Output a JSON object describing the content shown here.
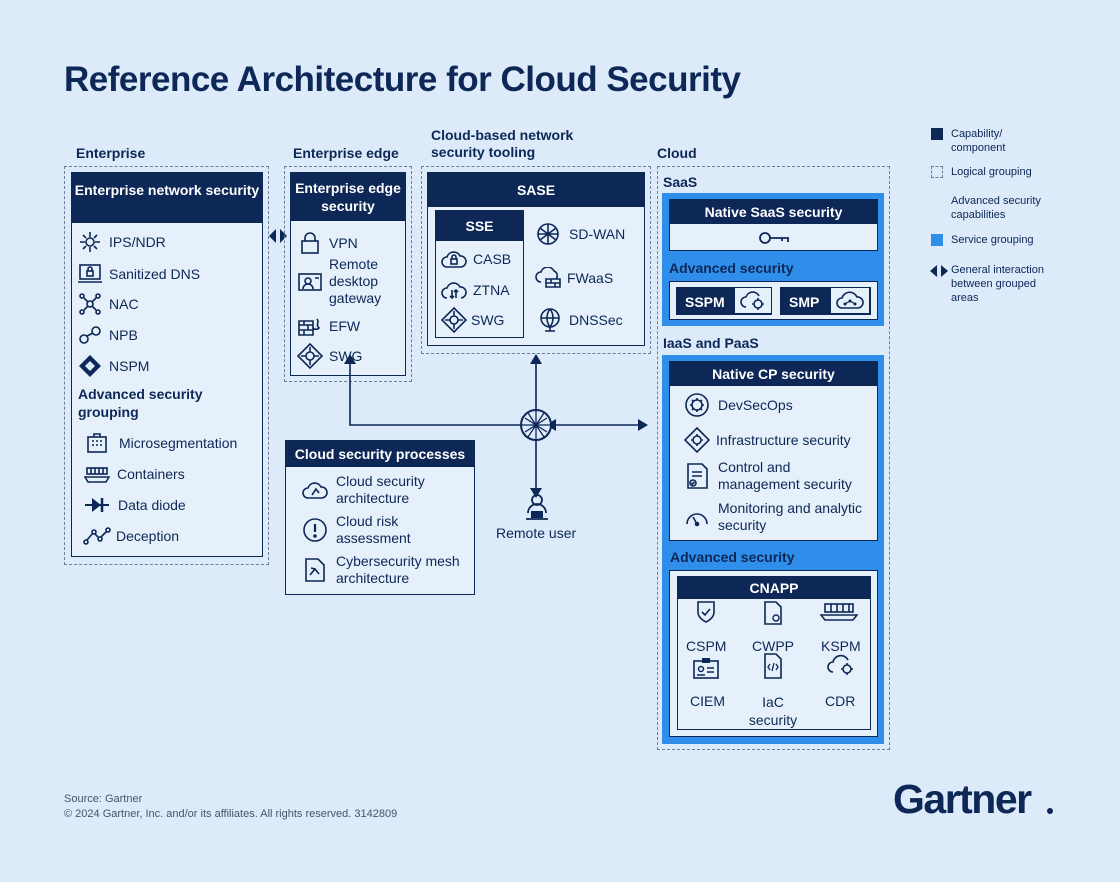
{
  "title": "Reference Architecture for Cloud Security",
  "columns": {
    "enterprise": "Enterprise",
    "enterprise_edge": "Enterprise edge",
    "cloud_network": "Cloud-based network security tooling",
    "cloud": "Cloud"
  },
  "enterprise": {
    "header": "Enterprise network security",
    "items": [
      "IPS/NDR",
      "Sanitized DNS",
      "NAC",
      "NPB",
      "NSPM"
    ],
    "advanced_label": "Advanced security grouping",
    "advanced_items": [
      "Microsegmentation",
      "Containers",
      "Data diode",
      "Deception"
    ]
  },
  "edge": {
    "header": "Enterprise edge security",
    "items": [
      "VPN",
      "Remote desktop gateway",
      "EFW",
      "SWG"
    ]
  },
  "sase": {
    "header": "SASE",
    "sse_header": "SSE",
    "sse_items": [
      "CASB",
      "ZTNA",
      "SWG"
    ],
    "items": [
      "SD-WAN",
      "FWaaS",
      "DNSSec"
    ]
  },
  "processes": {
    "header": "Cloud security processes",
    "items": [
      "Cloud security architecture",
      "Cloud risk assessment",
      "Cybersecurity mesh architecture"
    ]
  },
  "remote_user": "Remote user",
  "saas": {
    "label": "SaaS",
    "header": "Native SaaS security",
    "advanced_label": "Advanced security",
    "badges": [
      "SSPM",
      "SMP"
    ]
  },
  "iaas": {
    "label": "IaaS and PaaS",
    "header": "Native CP security",
    "items": [
      "DevSecOps",
      "Infrastructure security",
      "Control and management security",
      "Monitoring and analytic security"
    ],
    "advanced_label": "Advanced security",
    "cnapp_header": "CNAPP",
    "cnapp_items": [
      "CSPM",
      "CWPP",
      "KSPM",
      "CIEM",
      "IaC security",
      "CDR"
    ]
  },
  "legend": [
    {
      "label": "Capability/ component"
    },
    {
      "label": "Logical grouping"
    },
    {
      "label": "Advanced security capabilities"
    },
    {
      "label": "Service grouping"
    },
    {
      "label": "General interaction between grouped areas"
    }
  ],
  "footer": {
    "source": "Source: Gartner",
    "copyright": "© 2024 Gartner, Inc. and/or its affiliates. All rights reserved. 3142809",
    "logo": "Gartner"
  },
  "colors": {
    "navy": "#0d2756",
    "service_blue": "#2f8eea",
    "background": "#dceaf9"
  }
}
